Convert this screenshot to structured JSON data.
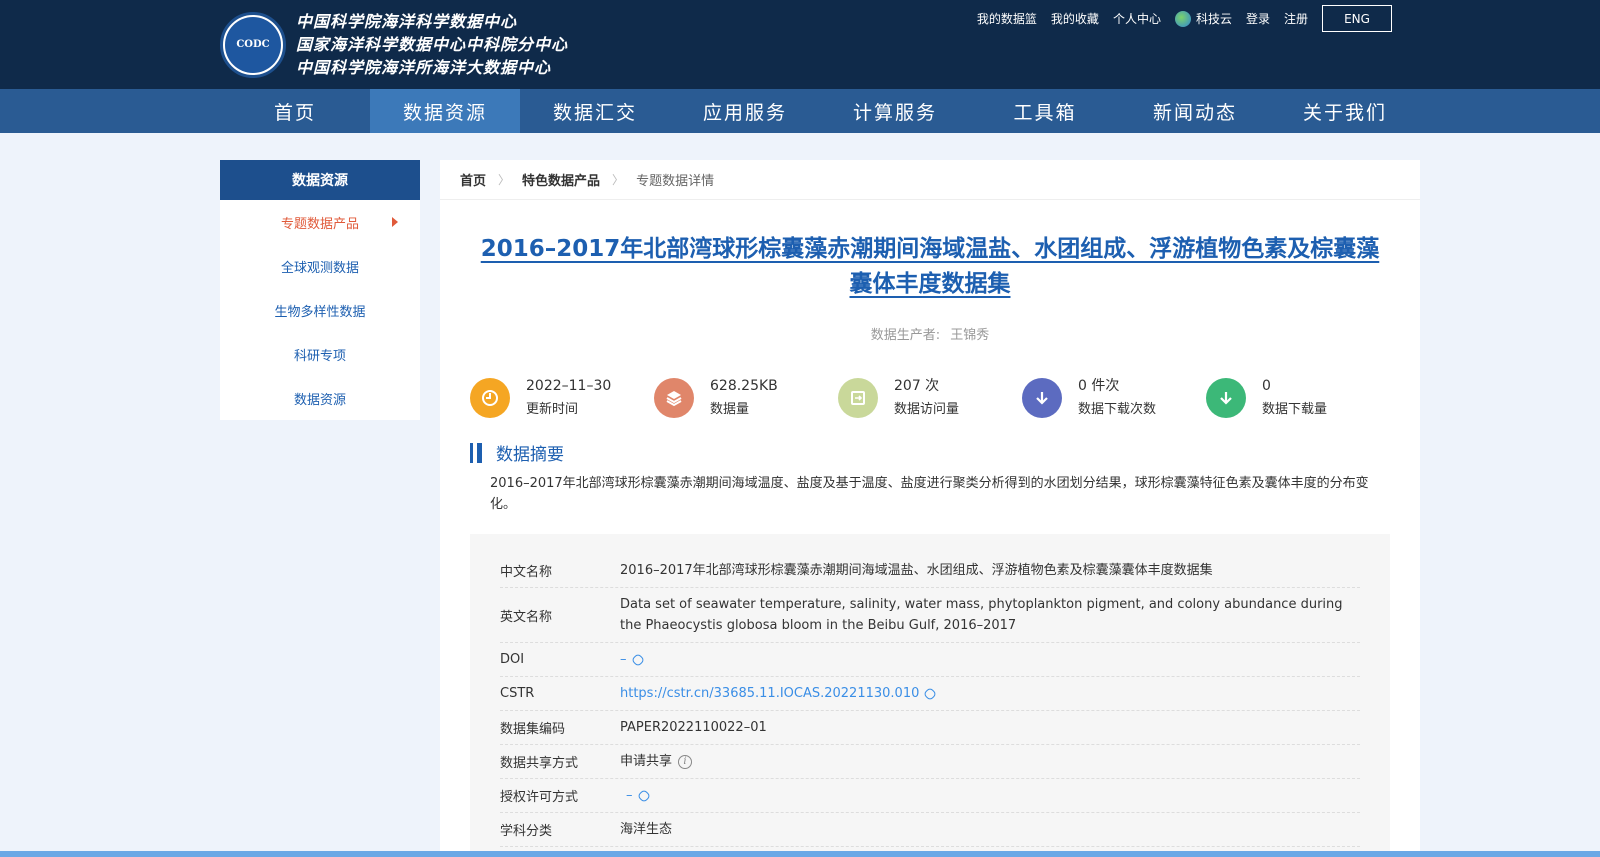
{
  "header": {
    "logo_text": "CODC",
    "org_lines": [
      "中国科学院海洋科学数据中心",
      "国家海洋科学数据中心中科院分中心",
      "中国科学院海洋所海洋大数据中心"
    ],
    "top_links": [
      "我的数据篮",
      "我的收藏",
      "个人中心"
    ],
    "kejiyun": "科技云",
    "login": "登录",
    "register": "注册",
    "lang_button": "ENG"
  },
  "nav": {
    "items": [
      "首页",
      "数据资源",
      "数据汇交",
      "应用服务",
      "计算服务",
      "工具箱",
      "新闻动态",
      "关于我们"
    ],
    "active": "数据资源"
  },
  "sidebar": {
    "title": "数据资源",
    "items": [
      "专题数据产品",
      "全球观测数据",
      "生物多样性数据",
      "科研专项",
      "数据资源"
    ]
  },
  "breadcrumb": [
    "首页",
    "特色数据产品",
    "专题数据详情"
  ],
  "dataset": {
    "title": "2016–2017年北部湾球形棕囊藻赤潮期间海域温盐、水团组成、浮游植物色素及棕囊藻囊体丰度数据集",
    "producer_label": "数据生产者:",
    "producer": "王锦秀",
    "stats": [
      {
        "value": "2022–11–30",
        "label": "更新时间",
        "icon": "clock-icon",
        "color": "#f5a623"
      },
      {
        "value": "628.25KB",
        "label": "数据量",
        "icon": "layers-icon",
        "color": "#e0866a"
      },
      {
        "value": "207 次",
        "label": "数据访问量",
        "icon": "visit-icon",
        "color": "#c9d89a"
      },
      {
        "value": "0 件次",
        "label": "数据下载次数",
        "icon": "download-icon",
        "color": "#5c6bc0"
      },
      {
        "value": "0",
        "label": "数据下载量",
        "icon": "download-icon",
        "color": "#3cb878"
      }
    ],
    "abstract_title": "数据摘要",
    "abstract": "2016–2017年北部湾球形棕囊藻赤潮期间海域温度、盐度及基于温度、盐度进行聚类分析得到的水团划分结果，球形棕囊藻特征色素及囊体丰度的分布变化。",
    "meta": {
      "cn_name_label": "中文名称",
      "cn_name": "2016–2017年北部湾球形棕囊藻赤潮期间海域温盐、水团组成、浮游植物色素及棕囊藻囊体丰度数据集",
      "en_name_label": "英文名称",
      "en_name": "Data set of seawater temperature, salinity, water mass, phytoplankton pigment, and colony abundance during the Phaeocystis globosa bloom in the Beibu Gulf, 2016–2017",
      "doi_label": "DOI",
      "doi": "–",
      "cstr_label": "CSTR",
      "cstr": "https://cstr.cn/33685.11.IOCAS.20221130.010",
      "code_label": "数据集编码",
      "code": "PAPER2022110022–01",
      "share_label": "数据共享方式",
      "share": "申请共享",
      "license_label": "授权许可方式",
      "license": "–",
      "subject_label": "学科分类",
      "subject": "海洋生态"
    }
  }
}
